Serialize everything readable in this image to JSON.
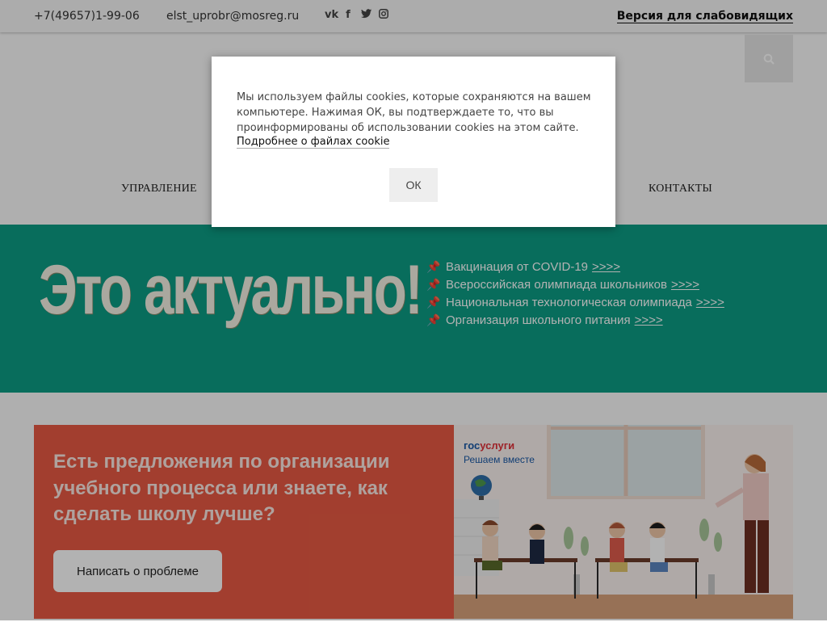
{
  "header": {
    "phone": "+7(49657)1-99-06",
    "email": "elst_uprobr@mosreg.ru",
    "social": [
      "vk-icon",
      "facebook-icon",
      "twitter-icon",
      "instagram-icon"
    ],
    "low_vision_label": "Версия для слабовидящих"
  },
  "nav": {
    "items": [
      "УПРАВЛЕНИЕ",
      "КОНТАКТЫ"
    ]
  },
  "banner": {
    "headline": "Это актуально!",
    "links": [
      {
        "text": "Вакцинация от COVID-19",
        "arrow": ">>>>"
      },
      {
        "text": "Всероссийская олимпиада школьников",
        "arrow": ">>>>"
      },
      {
        "text": "Национальная технологическая олимпиада",
        "arrow": ">>>>"
      },
      {
        "text": "Организация школьного питания",
        "arrow": ">>>>"
      }
    ]
  },
  "promo": {
    "title": "Есть предложения по организации учебного процесса или знаете, как сделать школу лучше?",
    "button_label": "Написать о проблеме",
    "gosuslugi_gos": "гос",
    "gosuslugi_uslugi": "услуги",
    "gosuslugi_slogan": "Решаем вместе"
  },
  "cookie_modal": {
    "text": "Мы используем файлы cookies, которые сохраняются на вашем компьютере. Нажимая ОК, вы подтверждаете то, что вы проинформированы об использовании cookies на этом сайте.",
    "more_link": "Подробнее о файлах cookie",
    "ok_label": "ОК"
  },
  "colors": {
    "banner": "#0c9c85",
    "promo": "#e85a44",
    "overlay": "rgba(0,0,0,0.3)"
  }
}
